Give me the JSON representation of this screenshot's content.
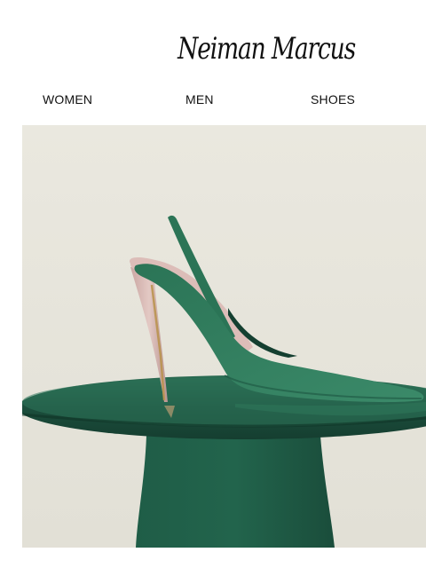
{
  "brand": {
    "name": "Neiman Marcus"
  },
  "nav": {
    "items": [
      {
        "label": "WOMEN"
      },
      {
        "label": "MEN"
      },
      {
        "label": "SHOES"
      }
    ]
  },
  "hero": {
    "subject": "green-slingback-pump-on-green-pedestal-table",
    "colors": {
      "background": "#e7e5dc",
      "shoe": "#2f7a5c",
      "table": "#1f5a45",
      "heel": "#d7b6b3"
    }
  }
}
